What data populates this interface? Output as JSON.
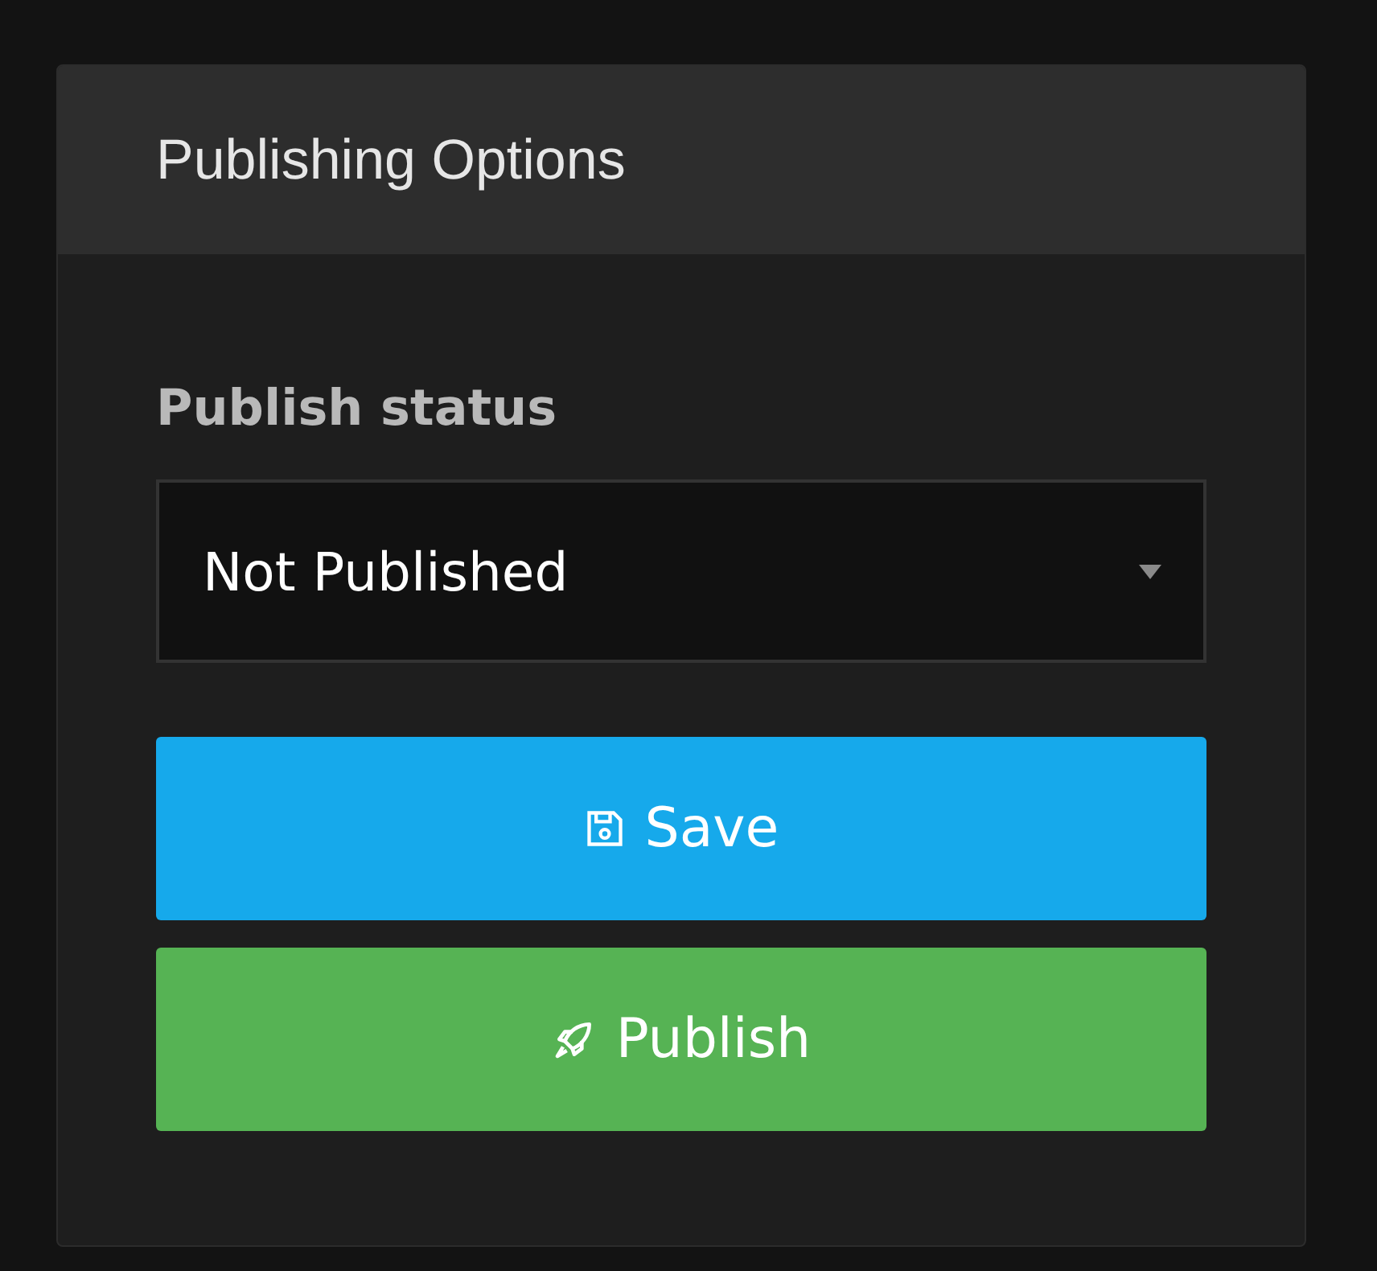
{
  "panel": {
    "title": "Publishing Options"
  },
  "publish_status": {
    "label": "Publish status",
    "value": "Not Published"
  },
  "buttons": [
    {
      "label": "Save",
      "kind": "save"
    },
    {
      "label": "Publish",
      "kind": "publish"
    }
  ]
}
